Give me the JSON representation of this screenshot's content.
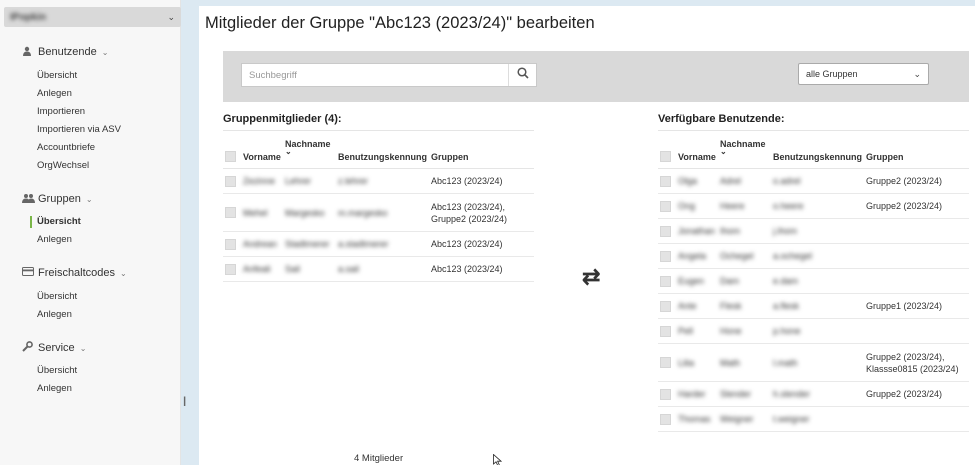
{
  "sidebar": {
    "school_selector": "IPopkin",
    "sections": [
      {
        "label": "Benutzende",
        "items": [
          "Übersicht",
          "Anlegen",
          "Importieren",
          "Importieren via ASV",
          "Accountbriefe",
          "OrgWechsel"
        ]
      },
      {
        "label": "Gruppen",
        "items": [
          "Übersicht",
          "Anlegen"
        ],
        "active_item": "Übersicht"
      },
      {
        "label": "Freischaltcodes",
        "items": [
          "Übersicht",
          "Anlegen"
        ]
      },
      {
        "label": "Service",
        "items": [
          "Übersicht",
          "Anlegen"
        ]
      }
    ]
  },
  "main": {
    "title": "Mitglieder der Gruppe \"Abc123 (2023/24)\" bearbeiten",
    "search": {
      "placeholder": "Suchbegriff",
      "value": ""
    },
    "group_filter": {
      "selected": "alle Gruppen"
    },
    "members": {
      "title": "Gruppenmitglieder (4):",
      "columns": {
        "vorname": "Vorname",
        "nachname": "Nachname",
        "kennung": "Benutzungskennung",
        "gruppen": "Gruppen"
      },
      "rows": [
        {
          "vorname": "Zezinne",
          "nachname": "Lehrer",
          "kennung": "z.lehrer",
          "gruppen": "Abc123 (2023/24)"
        },
        {
          "vorname": "Mehel",
          "nachname": "Margesko",
          "kennung": "m.margesko",
          "gruppen": "Abc123 (2023/24), Gruppe2 (2023/24)"
        },
        {
          "vorname": "Andrean",
          "nachname": "Stadtmerer",
          "kennung": "a.stadtmerer",
          "gruppen": "Abc123 (2023/24)"
        },
        {
          "vorname": "Anfeali",
          "nachname": "Sail",
          "kennung": "a.sail",
          "gruppen": "Abc123 (2023/24)"
        }
      ],
      "count_label": "4 Mitglieder"
    },
    "available": {
      "title": "Verfügbare Benutzende:",
      "columns": {
        "vorname": "Vorname",
        "nachname": "Nachname",
        "kennung": "Benutzungskennung",
        "gruppen": "Gruppen"
      },
      "rows": [
        {
          "vorname": "Olga",
          "nachname": "Adrel",
          "kennung": "o.adrel",
          "gruppen": "Gruppe2 (2023/24)"
        },
        {
          "vorname": "Ong",
          "nachname": "Heere",
          "kennung": "o.heere",
          "gruppen": "Gruppe2 (2023/24)"
        },
        {
          "vorname": "Jonathan",
          "nachname": "Ihom",
          "kennung": "j.ihom",
          "gruppen": ""
        },
        {
          "vorname": "Angela",
          "nachname": "Ochegel",
          "kennung": "a.ochegel",
          "gruppen": ""
        },
        {
          "vorname": "Eugen",
          "nachname": "Dam",
          "kennung": "e.dam",
          "gruppen": ""
        },
        {
          "vorname": "Ante",
          "nachname": "Flesk",
          "kennung": "a.flesk",
          "gruppen": "Gruppe1 (2023/24)"
        },
        {
          "vorname": "Pell",
          "nachname": "Hone",
          "kennung": "p.hone",
          "gruppen": ""
        },
        {
          "vorname": "Lilia",
          "nachname": "Math",
          "kennung": "l.math",
          "gruppen": "Gruppe2 (2023/24), Klassse0815 (2023/24)"
        },
        {
          "vorname": "Harder",
          "nachname": "Slender",
          "kennung": "h.slender",
          "gruppen": "Gruppe2 (2023/24)"
        },
        {
          "vorname": "Thomas",
          "nachname": "Weigner",
          "kennung": "t.weigner",
          "gruppen": ""
        }
      ]
    }
  }
}
